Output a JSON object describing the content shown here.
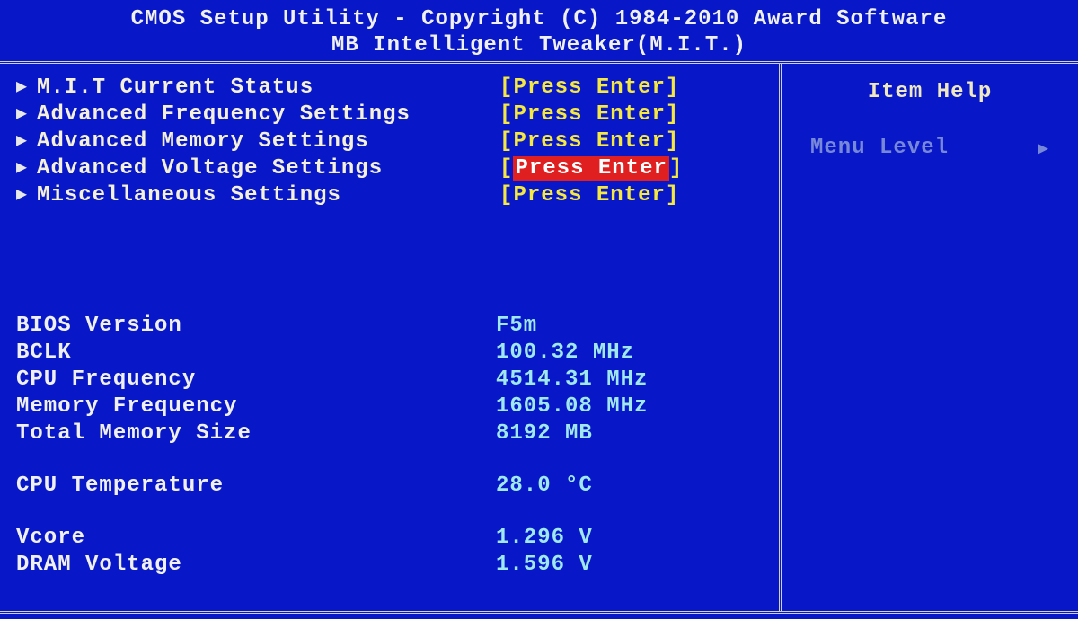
{
  "header": {
    "line1": "CMOS Setup Utility - Copyright (C) 1984-2010 Award Software",
    "line2": "MB Intelligent Tweaker(M.I.T.)"
  },
  "menu": [
    {
      "label": "M.I.T Current Status",
      "value": "Press Enter",
      "highlight": false
    },
    {
      "label": "Advanced Frequency Settings",
      "value": "Press Enter",
      "highlight": false
    },
    {
      "label": "Advanced Memory Settings",
      "value": "Press Enter",
      "highlight": false
    },
    {
      "label": "Advanced Voltage Settings",
      "value": "Press Enter",
      "highlight": true
    },
    {
      "label": "Miscellaneous Settings",
      "value": "Press Enter",
      "highlight": false
    }
  ],
  "info": {
    "bios_version_label": "BIOS Version",
    "bios_version_value": "F5m",
    "bclk_label": "BCLK",
    "bclk_value": "100.32 MHz",
    "cpu_freq_label": "CPU Frequency",
    "cpu_freq_value": "4514.31 MHz",
    "mem_freq_label": "Memory Frequency",
    "mem_freq_value": "1605.08 MHz",
    "total_mem_label": "Total Memory Size",
    "total_mem_value": "8192 MB",
    "cpu_temp_label": "CPU Temperature",
    "cpu_temp_value": "28.0 °C",
    "vcore_label": "Vcore",
    "vcore_value": "1.296 V",
    "dram_voltage_label": "DRAM Voltage",
    "dram_voltage_value": "1.596 V"
  },
  "help": {
    "title": "Item Help",
    "menu_level": "Menu Level"
  }
}
